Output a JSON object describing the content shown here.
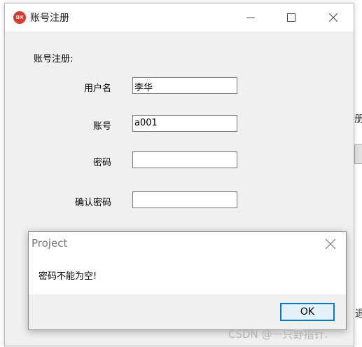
{
  "window": {
    "title": "账号注册",
    "app_icon_text": "DX",
    "buttons": [
      "minimize",
      "maximize",
      "close"
    ]
  },
  "form": {
    "section_title": "账号注册:",
    "fields": [
      {
        "label": "用户名",
        "value": ""
      },
      {
        "label": "账号",
        "value": ""
      },
      {
        "label": "密码",
        "value": ""
      },
      {
        "label": "确认密码",
        "value": ""
      }
    ],
    "username_value": "李华",
    "account_value": "a001"
  },
  "background_edge": {
    "glyph_top": "册",
    "glyph_bottom": "退"
  },
  "dialog": {
    "title": "Project",
    "message": "密码不能为空!",
    "ok_label": "OK"
  },
  "watermark": "CSDN @一只野指针."
}
